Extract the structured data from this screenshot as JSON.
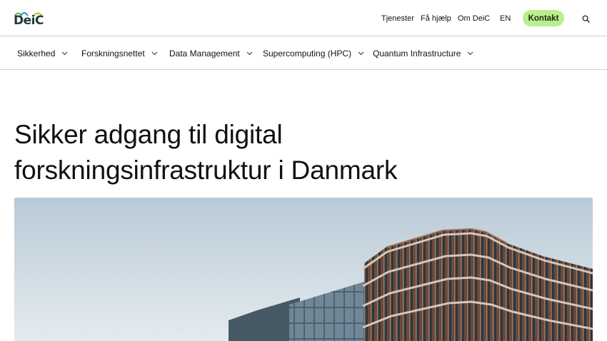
{
  "brand": {
    "logo_text": "DeiC",
    "logo_colors": [
      "#4fb84a",
      "#2a8fb8",
      "#c9b23a"
    ]
  },
  "topnav": {
    "links": [
      "Tjenester",
      "Få hjælp",
      "Om DeiC",
      "EN"
    ],
    "contact_label": "Kontakt",
    "contact_color": "#b9ef8c",
    "search_icon": "search-icon"
  },
  "mainnav": {
    "items": [
      {
        "label": "Sikkerhed",
        "icon": "chevron-down-icon"
      },
      {
        "label": "Forskningsnettet",
        "icon": "chevron-down-icon"
      },
      {
        "label": "Data Management",
        "icon": "chevron-down-icon"
      },
      {
        "label": "Supercomputing (HPC)",
        "icon": "chevron-down-icon"
      },
      {
        "label": "Quantum Infrastructure",
        "icon": "chevron-down-icon"
      }
    ]
  },
  "hero": {
    "title_line1": "Sikker adgang til digital",
    "title_line2": "forskningsinfrastruktur i Danmark"
  }
}
